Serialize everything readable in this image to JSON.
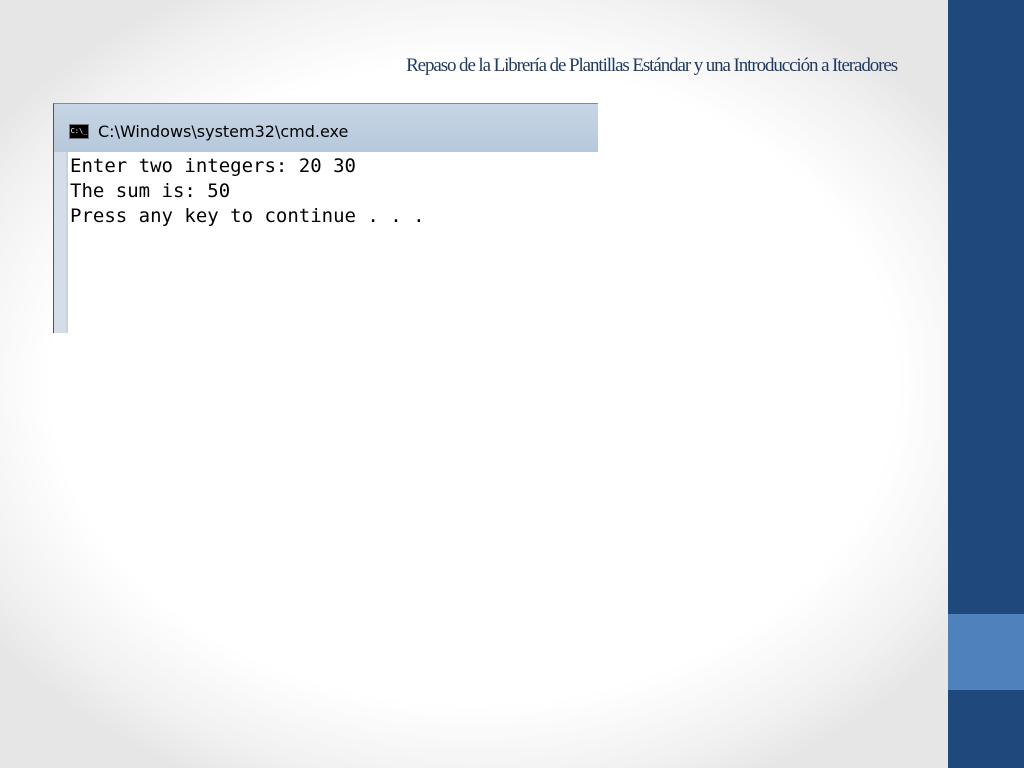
{
  "slide": {
    "title": "Repaso de la Librería de Plantillas Estándar y una Introducción a  Iteradores"
  },
  "window": {
    "title": "C:\\Windows\\system32\\cmd.exe",
    "icon_label": "C:\\_"
  },
  "console": {
    "lines": [
      "Enter two integers: 20 30",
      "The sum is: 50",
      "Press any key to continue . . ."
    ]
  },
  "colors": {
    "side_bar": "#1f497d",
    "side_accent": "#4f81bd",
    "title_text": "#1f3b63"
  }
}
